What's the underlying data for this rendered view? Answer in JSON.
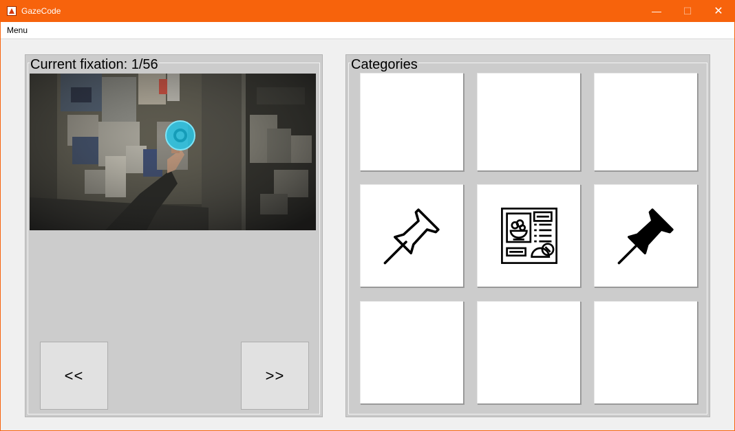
{
  "window": {
    "title": "GazeCode",
    "menu_label": "Menu",
    "accent_color": "#f7630c",
    "controls": [
      "minimize-icon",
      "maximize-icon",
      "close-icon"
    ]
  },
  "fixation_panel": {
    "label": "Current fixation: 1/56",
    "scene_image": "scene-camera-frame",
    "gaze_marker_color": "#29c5e6",
    "prev_label": "<<",
    "next_label": ">>"
  },
  "categories_panel": {
    "label": "Categories",
    "buttons": [
      {
        "icon": ""
      },
      {
        "icon": ""
      },
      {
        "icon": ""
      },
      {
        "icon": "pushpin-outline-icon"
      },
      {
        "icon": "recipe-card-icon"
      },
      {
        "icon": "pushpin-filled-icon"
      },
      {
        "icon": ""
      },
      {
        "icon": ""
      },
      {
        "icon": ""
      }
    ]
  }
}
